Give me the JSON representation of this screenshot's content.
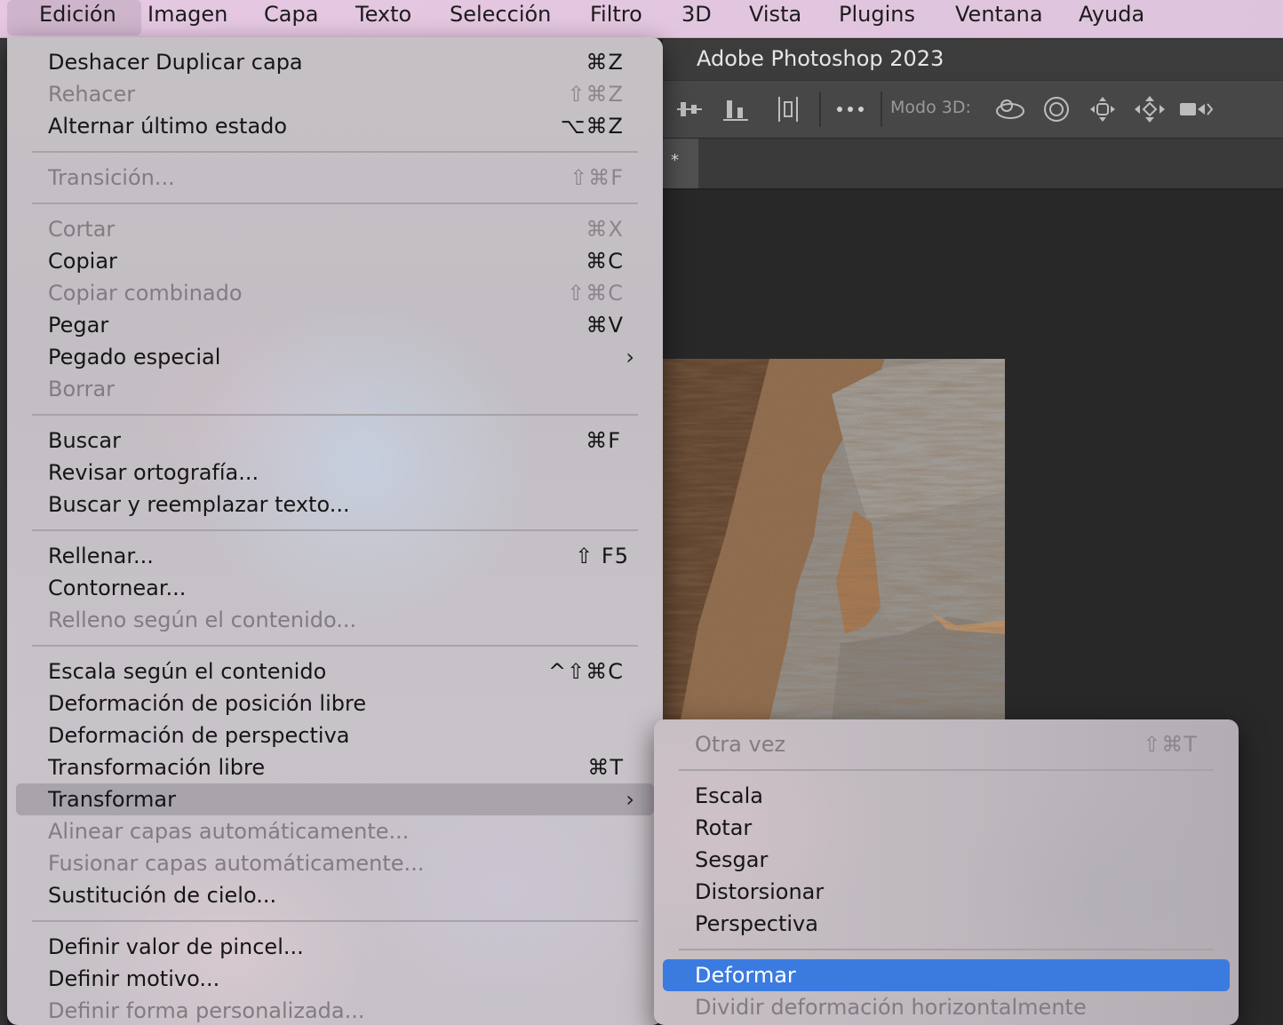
{
  "menubar": {
    "items": [
      "Edición",
      "Imagen",
      "Capa",
      "Texto",
      "Selección",
      "Filtro",
      "3D",
      "Vista",
      "Plugins",
      "Ventana",
      "Ayuda"
    ]
  },
  "window": {
    "title": "Adobe Photoshop 2023",
    "tab_label": "*",
    "options_bar": {
      "mode3d_label": "Modo 3D:"
    }
  },
  "edit_menu": {
    "items": [
      {
        "label": "Deshacer Duplicar capa",
        "shortcut": "⌘Z",
        "enabled": true
      },
      {
        "label": "Rehacer",
        "shortcut": "⇧⌘Z",
        "enabled": false
      },
      {
        "label": "Alternar último estado",
        "shortcut": "⌥⌘Z",
        "enabled": true
      },
      {
        "label": "Transición...",
        "shortcut": "⇧⌘F",
        "enabled": false
      },
      {
        "label": "Cortar",
        "shortcut": "⌘X",
        "enabled": false
      },
      {
        "label": "Copiar",
        "shortcut": "⌘C",
        "enabled": true
      },
      {
        "label": "Copiar combinado",
        "shortcut": "⇧⌘C",
        "enabled": false
      },
      {
        "label": "Pegar",
        "shortcut": "⌘V",
        "enabled": true
      },
      {
        "label": "Pegado especial",
        "shortcut": "",
        "enabled": true,
        "submenu": true
      },
      {
        "label": "Borrar",
        "shortcut": "",
        "enabled": false
      },
      {
        "label": "Buscar",
        "shortcut": "⌘F",
        "enabled": true
      },
      {
        "label": "Revisar ortografía...",
        "shortcut": "",
        "enabled": true
      },
      {
        "label": "Buscar y reemplazar texto...",
        "shortcut": "",
        "enabled": true
      },
      {
        "label": "Rellenar...",
        "shortcut": "⇧ F5",
        "enabled": true
      },
      {
        "label": "Contornear...",
        "shortcut": "",
        "enabled": true
      },
      {
        "label": "Relleno según el contenido...",
        "shortcut": "",
        "enabled": false
      },
      {
        "label": "Escala según el contenido",
        "shortcut": "^⇧⌘C",
        "enabled": true
      },
      {
        "label": "Deformación de posición libre",
        "shortcut": "",
        "enabled": true
      },
      {
        "label": "Deformación de perspectiva",
        "shortcut": "",
        "enabled": true
      },
      {
        "label": "Transformación libre",
        "shortcut": "⌘T",
        "enabled": true
      },
      {
        "label": "Transformar",
        "shortcut": "",
        "enabled": true,
        "submenu": true,
        "highlighted": true
      },
      {
        "label": "Alinear capas automáticamente...",
        "shortcut": "",
        "enabled": false
      },
      {
        "label": "Fusionar capas automáticamente...",
        "shortcut": "",
        "enabled": false
      },
      {
        "label": "Sustitución de cielo...",
        "shortcut": "",
        "enabled": true
      },
      {
        "label": "Definir valor de pincel...",
        "shortcut": "",
        "enabled": true
      },
      {
        "label": "Definir motivo...",
        "shortcut": "",
        "enabled": true
      },
      {
        "label": "Definir forma personalizada...",
        "shortcut": "",
        "enabled": false
      }
    ]
  },
  "transform_submenu": {
    "items": [
      {
        "label": "Otra vez",
        "shortcut": "⇧⌘T",
        "enabled": false
      },
      {
        "label": "Escala",
        "shortcut": "",
        "enabled": true
      },
      {
        "label": "Rotar",
        "shortcut": "",
        "enabled": true
      },
      {
        "label": "Sesgar",
        "shortcut": "",
        "enabled": true
      },
      {
        "label": "Distorsionar",
        "shortcut": "",
        "enabled": true
      },
      {
        "label": "Perspectiva",
        "shortcut": "",
        "enabled": true
      },
      {
        "label": "Deformar",
        "shortcut": "",
        "enabled": true,
        "selected": true
      },
      {
        "label": "Dividir deformación horizontalmente",
        "shortcut": "",
        "enabled": false
      }
    ]
  },
  "colors": {
    "selection_blue": "#3b7be0",
    "hover_gray": "#a9a3ab"
  }
}
